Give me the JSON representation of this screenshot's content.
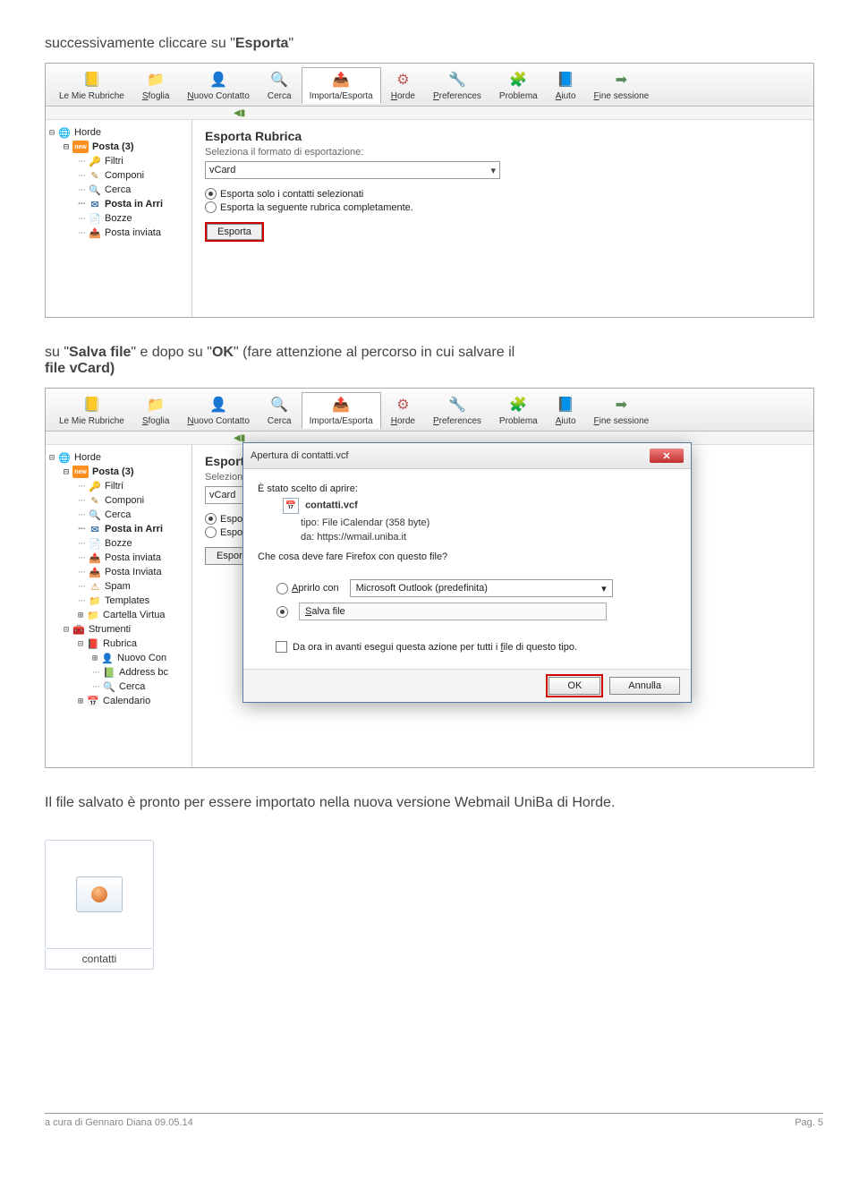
{
  "instructions": {
    "line1_a": "successivamente cliccare su \"",
    "line1_b": "Esporta",
    "line1_c": "\"",
    "line2_a": "su \"",
    "line2_b": "Salva file",
    "line2_c": "\" e dopo su \"",
    "line2_d": "OK",
    "line2_e": "\" (fare attenzione al percorso in cui salvare il",
    "line2_f": "file vCard)",
    "line3": "Il file salvato è pronto per essere importato nella nuova versione Webmail UniBa di Horde."
  },
  "toolbar": {
    "rubriche": "Le Mie Rubriche",
    "sfoglia": "Sfoglia",
    "nuovo": "Nuovo Contatto",
    "cerca": "Cerca",
    "impexp": "Importa/Esporta",
    "horde": "Horde",
    "prefs": "Preferences",
    "problema": "Problema",
    "aiuto": "Aiuto",
    "fine": "Fine sessione"
  },
  "sidebar1": {
    "horde": "Horde",
    "posta": "Posta (3)",
    "filtri": "Filtri",
    "componi": "Componi",
    "cerca": "Cerca",
    "arrivo": "Posta in Arri",
    "bozze": "Bozze",
    "inviata": "Posta inviata"
  },
  "sidebar2": {
    "horde": "Horde",
    "posta": "Posta (3)",
    "filtri": "Filtri",
    "componi": "Componi",
    "cerca": "Cerca",
    "arrivo": "Posta in Arri",
    "bozze": "Bozze",
    "inviata": "Posta inviata",
    "inviata2": "Posta Inviata",
    "spam": "Spam",
    "templates": "Templates",
    "virtua": "Cartella Virtua",
    "strumenti": "Strumenti",
    "rubrica": "Rubrica",
    "nuovocon": "Nuovo Con",
    "addressbc": "Address bc",
    "cerca2": "Cerca",
    "calendario": "Calendario"
  },
  "export_panel": {
    "heading": "Esporta Rubrica",
    "subtitle": "Seleziona il formato di esportazione:",
    "select_value": "vCard",
    "radio1": "Esporta solo i contatti selezionati",
    "radio2": "Esporta la seguente rubrica completamente.",
    "button": "Esporta",
    "radio1_short": "Esporta solo i conta",
    "radio2_short": "Esporta la seguen"
  },
  "dialog": {
    "title": "Apertura di contatti.vcf",
    "intro": "È stato scelto di aprire:",
    "filename": "contatti.vcf",
    "tipo_label": "tipo:",
    "tipo_value": "File iCalendar (358 byte)",
    "da_label": "da:",
    "da_value": "https://wmail.uniba.it",
    "question": "Che cosa deve fare Firefox con questo file?",
    "aprirlo": "Aprirlo con",
    "app_value": "Microsoft Outlook (predefinita)",
    "salva": "Salva file",
    "remember": "Da ora in avanti esegui questa azione per tutti i file di questo tipo.",
    "ok": "OK",
    "annulla": "Annulla"
  },
  "file_thumb": {
    "label": "contatti"
  },
  "footer": {
    "left": "a cura di Gennaro Diana  09.05.14",
    "right": "Pag. 5"
  }
}
